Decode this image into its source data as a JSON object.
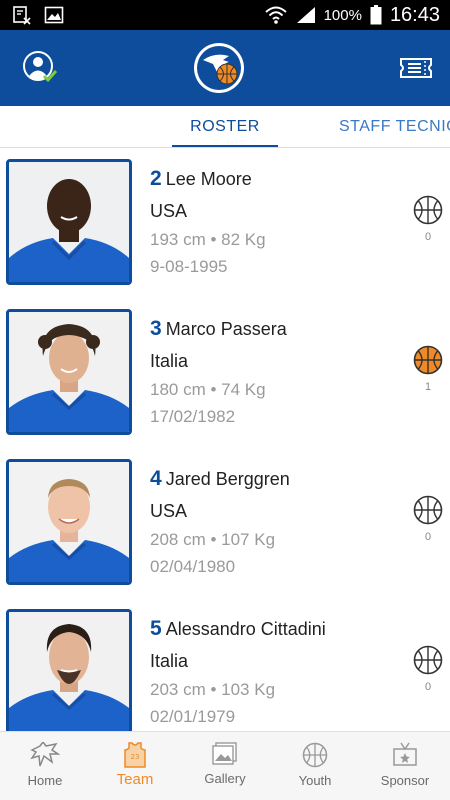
{
  "status_bar": {
    "battery": "100%",
    "time": "16:43"
  },
  "tabs": [
    {
      "label": "ROSTER",
      "active": true
    },
    {
      "label": "STAFF TECNIC",
      "active": false
    }
  ],
  "players": [
    {
      "number": "2",
      "name": "Lee Moore",
      "country": "USA",
      "stats": "193 cm • 82 Kg",
      "dob": "9-08-1995",
      "favorites": "0",
      "favorited": false
    },
    {
      "number": "3",
      "name": "Marco Passera",
      "country": "Italia",
      "stats": "180 cm • 74 Kg",
      "dob": "17/02/1982",
      "favorites": "1",
      "favorited": true
    },
    {
      "number": "4",
      "name": "Jared Berggren",
      "country": "USA",
      "stats": "208 cm • 107 Kg",
      "dob": "02/04/1980",
      "favorites": "0",
      "favorited": false
    },
    {
      "number": "5",
      "name": "Alessandro Cittadini",
      "country": "Italia",
      "stats": "203 cm • 103 Kg",
      "dob": "02/01/1979",
      "favorites": "0",
      "favorited": false
    }
  ],
  "bottom_nav": [
    {
      "label": "Home",
      "icon": "home-icon",
      "active": false
    },
    {
      "label": "Team",
      "icon": "jersey-icon",
      "active": true
    },
    {
      "label": "Gallery",
      "icon": "gallery-icon",
      "active": false
    },
    {
      "label": "Youth",
      "icon": "basketball-icon",
      "active": false
    },
    {
      "label": "Sponsor",
      "icon": "sponsor-icon",
      "active": false
    }
  ],
  "colors": {
    "primary": "#0d4d9b",
    "accent": "#f08a24",
    "tab_inactive": "#3a79c3"
  }
}
